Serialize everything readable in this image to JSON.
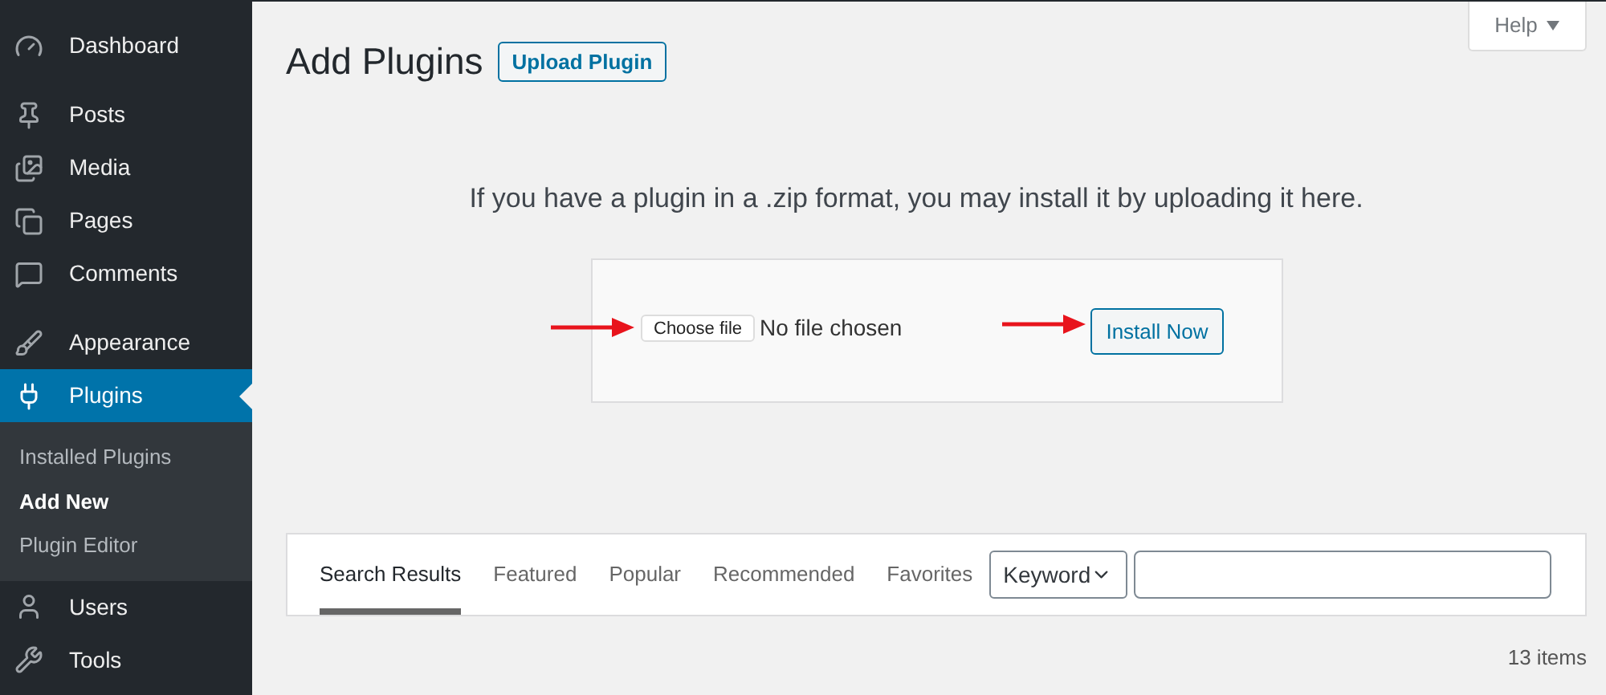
{
  "sidebar": {
    "groups": [
      [
        {
          "label": "Dashboard",
          "selected": false
        }
      ],
      [
        {
          "label": "Posts",
          "selected": false
        },
        {
          "label": "Media",
          "selected": false
        },
        {
          "label": "Pages",
          "selected": false
        },
        {
          "label": "Comments",
          "selected": false
        }
      ],
      [
        {
          "label": "Appearance",
          "selected": false
        },
        {
          "label": "Plugins",
          "selected": true,
          "children": [
            {
              "label": "Installed Plugins",
              "selected": false
            },
            {
              "label": "Add New",
              "selected": true
            },
            {
              "label": "Plugin Editor",
              "selected": false
            }
          ]
        },
        {
          "label": "Users",
          "selected": false
        },
        {
          "label": "Tools",
          "selected": false
        }
      ]
    ]
  },
  "help": {
    "label": "Help"
  },
  "page": {
    "title": "Add Plugins",
    "action": "Upload Plugin"
  },
  "upload": {
    "instructions": "If you have a plugin in a .zip format, you may install it by uploading it here.",
    "choose_button": "Choose file",
    "file_status": "No file chosen",
    "install_button": "Install Now"
  },
  "filter": {
    "tabs": [
      {
        "label": "Search Results",
        "selected": true
      },
      {
        "label": "Featured",
        "selected": false
      },
      {
        "label": "Popular",
        "selected": false
      },
      {
        "label": "Recommended",
        "selected": false
      },
      {
        "label": "Favorites",
        "selected": false
      }
    ],
    "search_type": "Keyword"
  },
  "count": "13 items"
}
